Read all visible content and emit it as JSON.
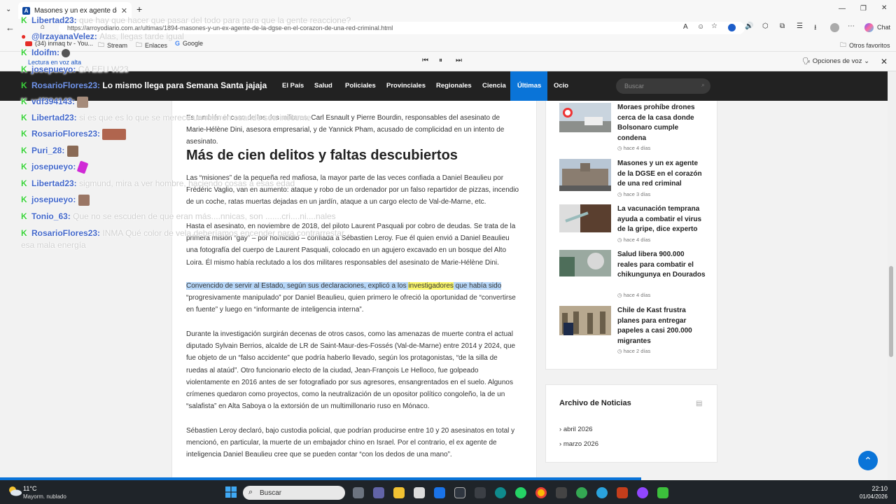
{
  "browser": {
    "tab_title": "Masones y un ex agente de la",
    "url": "https://arroyodiario.com.ar/ultimas/1894-masones-y-un-ex-agente-de-la-dgse-en-el-corazon-de-una-red-criminal.html",
    "chat_label": "Chat",
    "bookmarks": [
      "(34) inmaq tv - You...",
      "Stream",
      "Enlaces",
      "Google"
    ],
    "other_favorites": "Otros favoritos",
    "read_aloud_label": "Lectura en voz alta",
    "voice_options": "Opciones de voz"
  },
  "site_nav": {
    "items": [
      "El País",
      "Salud",
      "Policiales",
      "Provinciales",
      "Regionales",
      "Ciencia",
      "Últimas",
      "Ocio"
    ],
    "active": "Últimas",
    "search_placeholder": "Buscar"
  },
  "article": {
    "intro": "Es también el caso de los dos militares, Carl Esnault y Pierre Bourdin, responsables del asesinato de Marie-Hélène Dini, asesora empresarial, y de Yannick Pham, acusado de complicidad en un intento de asesinato.",
    "heading": "Más de cien delitos y faltas descubiertos",
    "p1": "Las “misiones” de la pequeña red mafiosa, la mayor parte de las veces confiada a Daniel Beaulieu por Frédéric Vaglio, van en aumento: ataque y robo de un ordenador por un falso repartidor de pizzas, incendio de un coche, ratas muertas dejadas en un jardín, ataque a un cargo electo de Val-de-Marne, etc.",
    "p2": "Hasta el asesinato, en noviembre de 2018, del piloto Laurent Pasquali por cobro de deudas. Se trata de la primera misión “gay” – por homicidio – confiada a Sébastien Leroy. Fue él quien envió a Daniel Beaulieu una fotografía del cuerpo de Laurent Pasquali, colocado en un agujero excavado en un bosque del Alto Loira. Él mismo había reclutado a los dos militares responsables del asesinato de Marie-Hélène Dini.",
    "p3_hl1": "Convencido de servir al Estado, según sus declaraciones, explicó a los ",
    "p3_hl2": "investigadores",
    "p3_hl3": " que había sido",
    "p3_rest": "“progresivamente manipulado” por Daniel Beaulieu, quien primero le ofreció la oportunidad de “convertirse en fuente” y luego en “informante de inteligencia interna”.",
    "p4": "Durante la investigación surgirán decenas de otros casos, como las amenazas de muerte contra el actual diputado Sylvain Berrios, alcalde de LR de Saint-Maur-des-Fossés (Val-de-Marne) entre 2014 y 2024, que fue objeto de un “falso accidente” que podría haberlo llevado, según los protagonistas, “de la silla de ruedas al ataúd”. Otro funcionario electo de la ciudad, Jean-François Le Helloco, fue golpeado violentamente en 2016 antes de ser fotografiado por sus agresores, ensangrentados en el suelo. Algunos crímenes quedaron como proyectos, como la neutralización de un opositor político congoleño, la de un “salafista” en Alta Saboya o la extorsión de un multimillonario ruso en Mónaco.",
    "p5": "Sébastien Leroy declaró, bajo custodia policial, que podrían producirse entre 10 y 20 asesinatos en total y mencionó, en particular, la muerte de un embajador chino en Israel. Por el contrario, el ex agente de inteligencia Daniel Beaulieu cree que se pueden contar “con los dedos de una mano”."
  },
  "sidebar": {
    "news": [
      {
        "title": "Moraes prohíbe drones cerca de la casa donde Bolsonaro cumple condena",
        "time": "hace 4 días"
      },
      {
        "title": "Masones y un ex agente de la DGSE en el corazón de una red criminal",
        "time": "hace 3 días"
      },
      {
        "title": "La vacunación temprana ayuda a combatir el virus de la gripe, dice experto",
        "time": "hace 4 días"
      },
      {
        "title": "Salud libera 900.000 reales para combatir el chikungunya en Dourados",
        "time": "hace 4 días"
      },
      {
        "title": "Chile de Kast frustra planes para entregar papeles a casi 200.000 migrantes",
        "time": "hace 2 días"
      }
    ],
    "archive_title": "Archivo de Noticias",
    "archive_items": [
      "abril 2026",
      "marzo 2026"
    ]
  },
  "chat_overlay": [
    {
      "user": "Libertad23:",
      "msg": "que hay que hacer que pasar del todo para para que la gente reaccione?",
      "icon": "kick"
    },
    {
      "user": "@IrzayanaVelez:",
      "msg": "Alas, llegas tarde igual",
      "icon": "youtube"
    },
    {
      "user": "Idoifm:",
      "msg": "",
      "icon": "kick",
      "emote": true
    },
    {
      "user": "josepueyo:",
      "msg": "CA EEU W23",
      "icon": "kick"
    },
    {
      "user": "RosarioFlores23:",
      "msg": "Lo mismo llega para Semana Santa jajaja",
      "icon": "kick",
      "bright": true
    },
    {
      "user": "vdf394143:",
      "msg": "",
      "icon": "kick",
      "emote": true
    },
    {
      "user": "Libertad23:",
      "msg": "si es que es lo que se merece un marrón cuando sea inocente",
      "icon": "kick"
    },
    {
      "user": "RosarioFlores23:",
      "msg": "",
      "icon": "kick",
      "emote": true
    },
    {
      "user": "Puri_28:",
      "msg": "",
      "icon": "kick",
      "emote": true
    },
    {
      "user": "josepueyo:",
      "msg": "",
      "icon": "kick",
      "emote": true
    },
    {
      "user": "Libertad23:",
      "msg": "sigmund, mira a ver hombre, haciendo cosas a esas edad",
      "icon": "kick"
    },
    {
      "user": "josepueyo:",
      "msg": "",
      "icon": "kick",
      "emote": true
    },
    {
      "user": "Tonio_63:",
      "msg": "Que no se escuden de que eran más....nnicas, son .......cri....ni....nales",
      "icon": "kick"
    },
    {
      "user": "RosarioFlores23:",
      "msg": "INMA Qué color de vela deberíamos encender para contrarrestar esa mala energía",
      "icon": "kick"
    }
  ],
  "taskbar": {
    "weather_temp": "11°C",
    "weather_desc": "Mayorm. nublado",
    "search_placeholder": "Buscar",
    "time": "22:10",
    "date": "01/04/2026"
  }
}
